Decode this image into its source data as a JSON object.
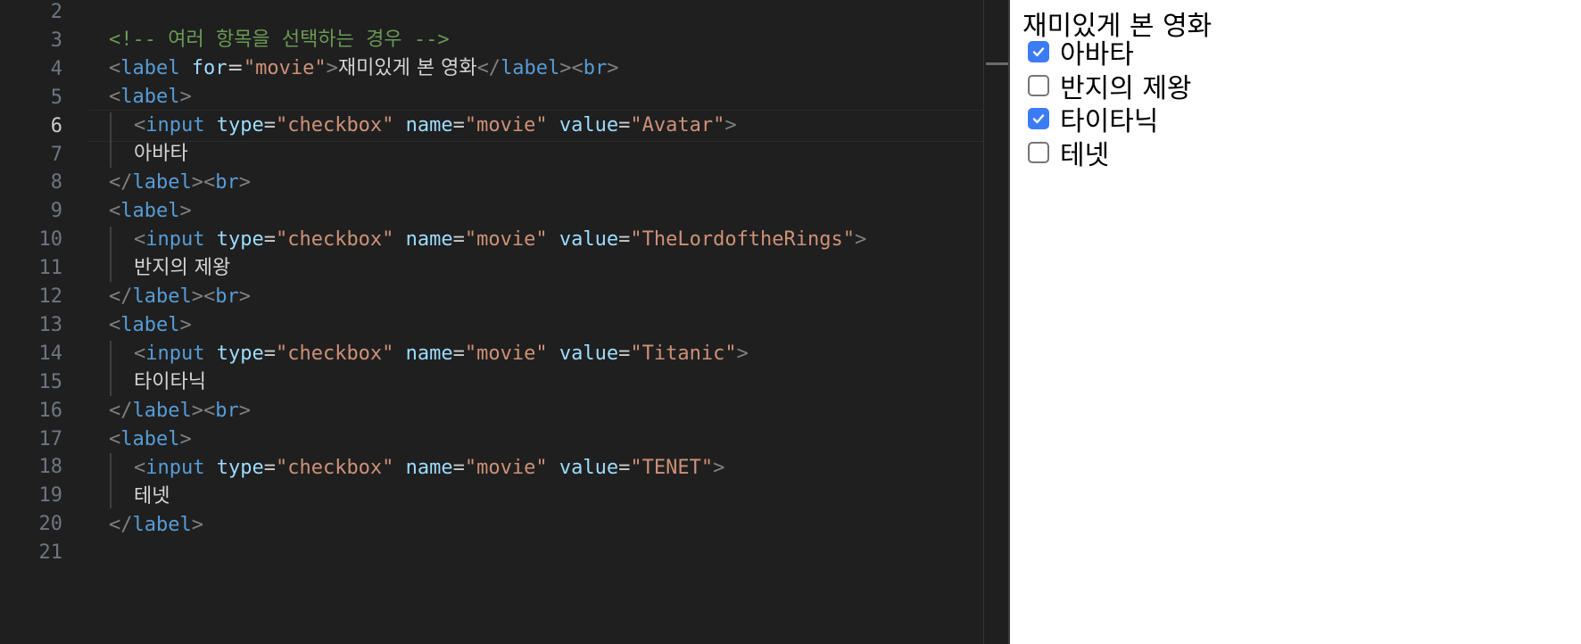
{
  "editor": {
    "line_numbers": [
      "2",
      "3",
      "4",
      "5",
      "6",
      "7",
      "8",
      "9",
      "10",
      "11",
      "12",
      "13",
      "14",
      "15",
      "16",
      "17",
      "18",
      "19",
      "20",
      "21"
    ],
    "active_line": "6",
    "lines": {
      "l3": {
        "comment": "<!-- 여러 항목을 선택하는 경우 -->"
      },
      "l4": {
        "t1": "<",
        "tag1": "label",
        "attr": "for",
        "eq": "=",
        "val": "\"movie\"",
        "t2": ">",
        "text": "재미있게 본 영화",
        "t3": "</",
        "tag2": "label",
        "t4": "><",
        "tag3": "br",
        "t5": ">"
      },
      "l5": {
        "t1": "<",
        "tag": "label",
        "t2": ">"
      },
      "l6": {
        "t1": "<",
        "tag": "input",
        "a1": "type",
        "v1": "\"checkbox\"",
        "a2": "name",
        "v2": "\"movie\"",
        "a3": "value",
        "v3": "\"Avatar\"",
        "t2": ">"
      },
      "l7": {
        "text": "아바타"
      },
      "l8": {
        "t1": "</",
        "tag1": "label",
        "t2": "><",
        "tag2": "br",
        "t3": ">"
      },
      "l9": {
        "t1": "<",
        "tag": "label",
        "t2": ">"
      },
      "l10": {
        "t1": "<",
        "tag": "input",
        "a1": "type",
        "v1": "\"checkbox\"",
        "a2": "name",
        "v2": "\"movie\"",
        "a3": "value",
        "v3": "\"TheLordoftheRings\"",
        "t2": ">"
      },
      "l11": {
        "text": "반지의 제왕"
      },
      "l12": {
        "t1": "</",
        "tag1": "label",
        "t2": "><",
        "tag2": "br",
        "t3": ">"
      },
      "l13": {
        "t1": "<",
        "tag": "label",
        "t2": ">"
      },
      "l14": {
        "t1": "<",
        "tag": "input",
        "a1": "type",
        "v1": "\"checkbox\"",
        "a2": "name",
        "v2": "\"movie\"",
        "a3": "value",
        "v3": "\"Titanic\"",
        "t2": ">"
      },
      "l15": {
        "text": "타이타닉"
      },
      "l16": {
        "t1": "</",
        "tag1": "label",
        "t2": "><",
        "tag2": "br",
        "t3": ">"
      },
      "l17": {
        "t1": "<",
        "tag": "label",
        "t2": ">"
      },
      "l18": {
        "t1": "<",
        "tag": "input",
        "a1": "type",
        "v1": "\"checkbox\"",
        "a2": "name",
        "v2": "\"movie\"",
        "a3": "value",
        "v3": "\"TENET\"",
        "t2": ">"
      },
      "l19": {
        "text": "테넷"
      },
      "l20": {
        "t1": "</",
        "tag": "label",
        "t2": ">"
      }
    }
  },
  "preview": {
    "title": "재미있게 본 영화",
    "items": [
      {
        "label": "아바타",
        "checked": true
      },
      {
        "label": "반지의 제왕",
        "checked": false
      },
      {
        "label": "타이타닉",
        "checked": true
      },
      {
        "label": "테넷",
        "checked": false
      }
    ],
    "check_color": "#3b7cf5"
  }
}
